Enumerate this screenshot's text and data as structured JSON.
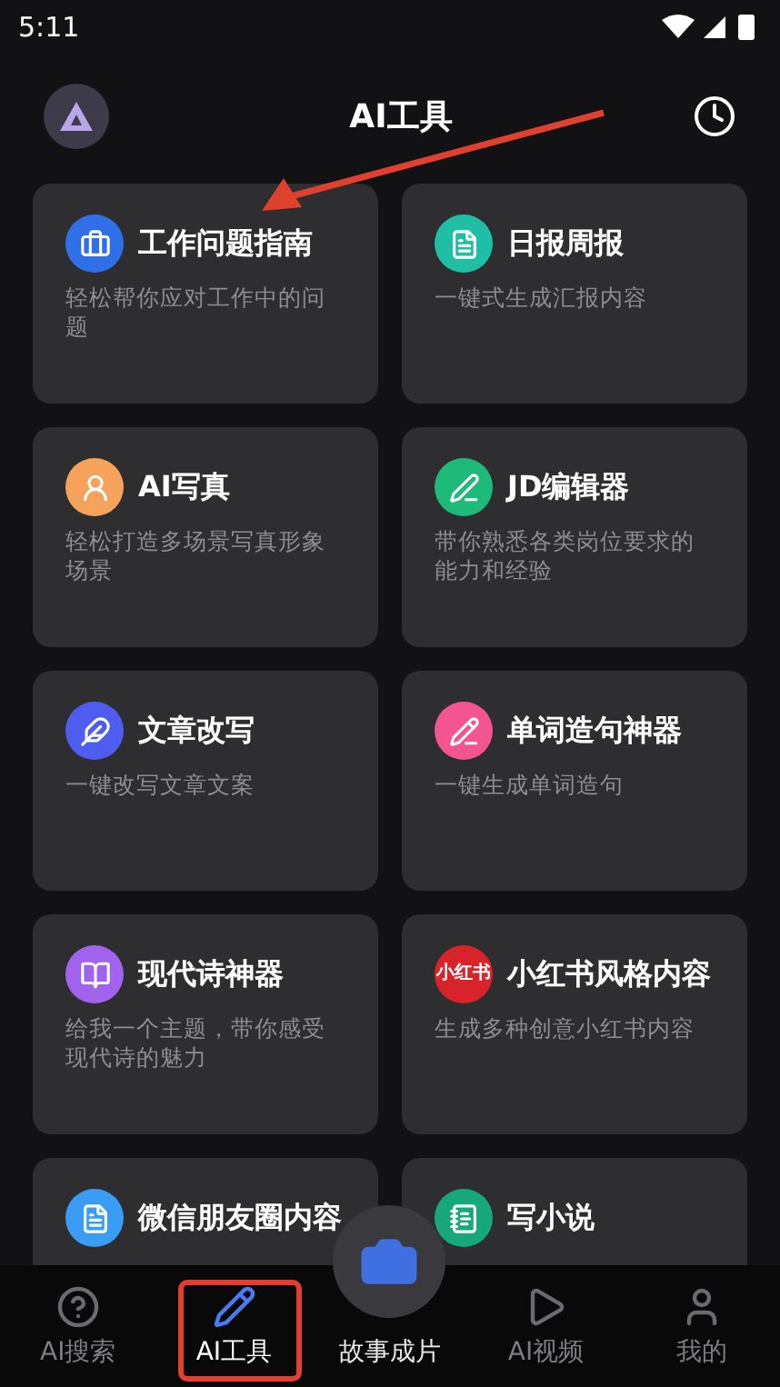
{
  "status_bar": {
    "time": "5:11"
  },
  "header": {
    "title": "AI工具"
  },
  "cards": [
    {
      "color": "#2f6fe8",
      "title": "工作问题指南",
      "description": "轻松帮你应对工作中的问题"
    },
    {
      "color": "#1fbfa6",
      "title": "日报周报",
      "description": "一键式生成汇报内容"
    },
    {
      "color": "#f5a35a",
      "title": "AI写真",
      "description": "轻松打造多场景写真形象场景"
    },
    {
      "color": "#1fb97a",
      "title": "JD编辑器",
      "description": "带你熟悉各类岗位要求的能力和经验"
    },
    {
      "color": "#4f5cf0",
      "title": "文章改写",
      "description": "一键改写文章文案"
    },
    {
      "color": "#f2558f",
      "title": "单词造句神器",
      "description": "一键生成单词造句"
    },
    {
      "color": "#a163ee",
      "title": "现代诗神器",
      "description": "给我一个主题，带你感受现代诗的魅力"
    },
    {
      "color": "#d8232a",
      "icon_text": "小红书",
      "title": "小红书风格内容",
      "description": "生成多种创意小红书内容"
    },
    {
      "color": "#3b9cf5",
      "title": "微信朋友圈内容"
    },
    {
      "color": "#16a87a",
      "title": "写小说"
    }
  ],
  "nav": [
    {
      "label": "AI搜索",
      "selected": false
    },
    {
      "label": "AI工具",
      "selected": true
    },
    {
      "label": "故事成片",
      "selected": false
    },
    {
      "label": "AI视频",
      "selected": false
    },
    {
      "label": "我的",
      "selected": false
    }
  ]
}
